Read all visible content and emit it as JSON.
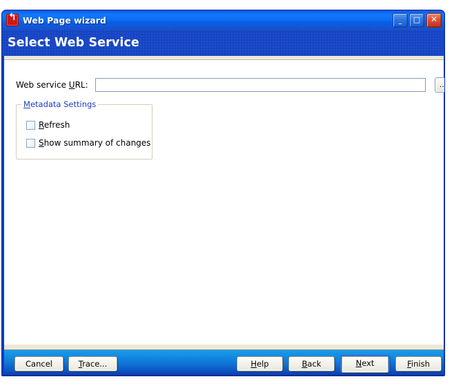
{
  "window": {
    "title": "Web Page wizard",
    "app_icon": "wizard-arrow-icon",
    "controls": {
      "minimize": "_",
      "maximize": "□",
      "close": "✕"
    }
  },
  "header": {
    "page_title": "Select Web Service",
    "band_color": "#1645c4"
  },
  "form": {
    "url_label_pre": "Web service ",
    "url_label_mnemonic": "U",
    "url_label_post": "RL:",
    "url_value": "",
    "url_placeholder": "",
    "browse_button": "...",
    "group": {
      "legend_mnemonic": "M",
      "legend_rest": "etadata Settings",
      "legend_color": "#1a3fbf",
      "checkboxes": [
        {
          "name": "refresh",
          "mnemonic": "R",
          "rest": "efresh",
          "checked": false
        },
        {
          "name": "show-summary-of-changes",
          "mnemonic": "S",
          "rest": "how summary of changes",
          "checked": false
        }
      ]
    }
  },
  "buttons": {
    "cancel": "Cancel",
    "trace_mnemonic": "T",
    "trace_rest": "race...",
    "help_mnemonic": "H",
    "help_rest": "elp",
    "back_mnemonic": "B",
    "back_rest": "ack",
    "next_mnemonic": "N",
    "next_rest": "ext",
    "finish_mnemonic": "F",
    "finish_rest": "inish",
    "default_focused": "next"
  }
}
